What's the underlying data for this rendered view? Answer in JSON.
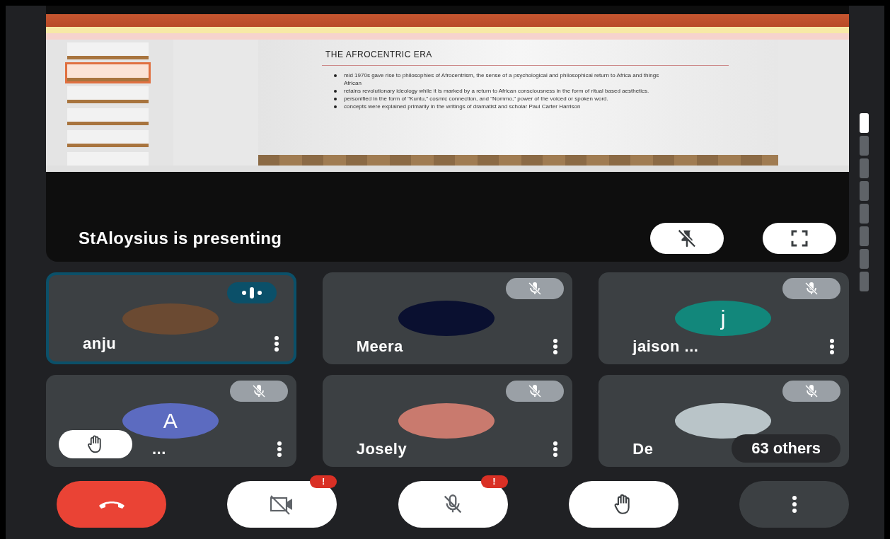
{
  "presentation": {
    "slide_thumbnails": [
      {
        "selected": false
      },
      {
        "selected": true
      },
      {
        "selected": false
      },
      {
        "selected": false
      },
      {
        "selected": false
      },
      {
        "selected": false
      }
    ],
    "slide": {
      "title": "THE AFROCENTRIC ERA",
      "bullets": [
        "mid 1970s gave rise to philosophies of Afrocentrism, the sense of a psychological and philosophical return to Africa and things African",
        "retains revolutionary ideology while it is marked by a return to African consciousness in the form of ritual based aesthetics.",
        "personified in the form of \"Kuntu,\" cosmic connection, and \"Nommo,\" power of the voiced or spoken word.",
        "concepts were explained primarily in the writings of dramatist and scholar Paul Carter Harrison"
      ]
    },
    "presenter_label": "StAloysius is presenting"
  },
  "participants": [
    {
      "name": "anju",
      "kind": "photo",
      "color": "#6b4a32",
      "speaking": true,
      "muted": false,
      "hand_raised": false
    },
    {
      "name": "Meera",
      "kind": "photo",
      "color": "#0a1030",
      "speaking": false,
      "muted": true,
      "hand_raised": false
    },
    {
      "name": "jaison ...",
      "kind": "letter",
      "letter": "j",
      "color": "#12877b",
      "speaking": false,
      "muted": true,
      "hand_raised": false
    },
    {
      "name": "...",
      "kind": "letter",
      "letter": "A",
      "color": "#5c6bc0",
      "speaking": false,
      "muted": true,
      "hand_raised": true
    },
    {
      "name": "Josely",
      "kind": "photo",
      "color": "#c97a6e",
      "speaking": false,
      "muted": true,
      "hand_raised": false
    },
    {
      "name": "De",
      "kind": "photo",
      "color": "#b9c4c8",
      "speaking": false,
      "muted": true,
      "hand_raised": false,
      "overflow": "63 others"
    }
  ],
  "controls": [
    {
      "kind": "end-call"
    },
    {
      "kind": "camera-off",
      "alert": "!"
    },
    {
      "kind": "mic-off",
      "alert": "!"
    },
    {
      "kind": "raise-hand"
    },
    {
      "kind": "more"
    }
  ]
}
